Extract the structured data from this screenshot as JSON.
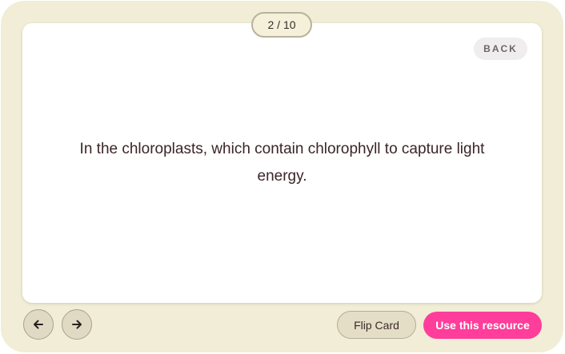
{
  "flashcard": {
    "counter": "2 / 10",
    "back_label": "BACK",
    "text": "In the chloroplasts, which contain chlorophyll to capture light energy."
  },
  "controls": {
    "prev_icon": "arrow-left-icon",
    "next_icon": "arrow-right-icon",
    "flip_label": "Flip Card",
    "use_label": "Use this resource"
  },
  "colors": {
    "frame": "#f1edd6",
    "accent": "#ff3d9a",
    "text": "#3b2527"
  }
}
